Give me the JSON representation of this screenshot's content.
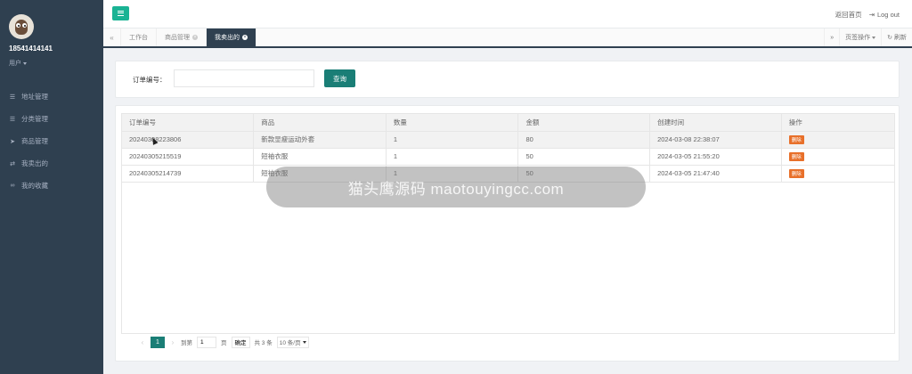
{
  "sidebar": {
    "user_name": "18541414141",
    "user_role": "用户",
    "items": [
      {
        "label": "地址管理",
        "icon": "list-icon"
      },
      {
        "label": "分类管理",
        "icon": "list-icon"
      },
      {
        "label": "商品管理",
        "icon": "send-icon"
      },
      {
        "label": "我卖出的",
        "icon": "exchange-icon"
      },
      {
        "label": "我的收藏",
        "icon": "link-icon"
      }
    ]
  },
  "topbar": {
    "home_link": "返回首页",
    "logout": "Log out"
  },
  "tabs": {
    "items": [
      {
        "label": "工作台",
        "closable": false,
        "active": false
      },
      {
        "label": "商品管理",
        "closable": true,
        "active": false
      },
      {
        "label": "我卖出的",
        "closable": true,
        "active": true
      }
    ],
    "page_ops": "页签操作",
    "refresh": "刷新"
  },
  "search": {
    "label": "订单编号：",
    "value": "",
    "button": "查询"
  },
  "table": {
    "columns": [
      "订单编号",
      "商品",
      "数量",
      "金额",
      "创建时间",
      "操作"
    ],
    "rows": [
      {
        "order_no": "20240308223806",
        "product": "新款显瘦运动外套",
        "qty": "1",
        "amount": "80",
        "created": "2024-03-08 22:38:07",
        "action": "删除"
      },
      {
        "order_no": "20240305215519",
        "product": "短袖衣服",
        "qty": "1",
        "amount": "50",
        "created": "2024-03-05 21:55:20",
        "action": "删除"
      },
      {
        "order_no": "20240305214739",
        "product": "短袖衣服",
        "qty": "1",
        "amount": "50",
        "created": "2024-03-05 21:47:40",
        "action": "删除"
      }
    ]
  },
  "pager": {
    "current": "1",
    "goto_label": "到第",
    "goto_value": "1",
    "page_label": "页",
    "confirm": "确定",
    "total": "共 3 条",
    "page_size": "10 条/页"
  },
  "watermark": {
    "text": "猫头鹰源码 maotouyingcc.com"
  }
}
